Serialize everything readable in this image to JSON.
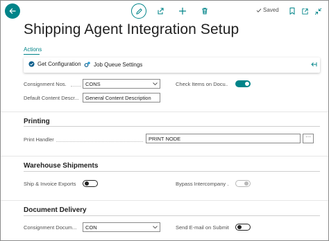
{
  "toolbar": {
    "saved_label": "Saved"
  },
  "page": {
    "title": "Shipping Agent Integration Setup"
  },
  "actions": {
    "tab_label": "Actions",
    "items": [
      {
        "label": "Get Configuration"
      },
      {
        "label": "Job Queue Settings"
      }
    ]
  },
  "general": {
    "consignment_nos": {
      "label": "Consignment Nos.",
      "value": "CONS"
    },
    "default_content": {
      "label": "Default Content Descr...",
      "value": "General Content Description"
    },
    "check_items": {
      "label": "Check Items on Docu...",
      "value": "on"
    }
  },
  "printing": {
    "title": "Printing",
    "print_handler": {
      "label": "Print Handler",
      "value": "PRINT NODE",
      "assist": "···"
    }
  },
  "warehouse": {
    "title": "Warehouse Shipments",
    "ship_invoice": {
      "label": "Ship & Invoice Exports",
      "value": "off"
    },
    "bypass": {
      "label": "Bypass Intercompany ...",
      "value": "on (disabled)"
    }
  },
  "delivery": {
    "title": "Document Delivery",
    "consignment_doc": {
      "label": "Consignment Docum...",
      "value": "CON"
    },
    "send_email": {
      "label": "Send E-mail on Submit",
      "value": "off"
    }
  },
  "colors": {
    "accent": "#008489",
    "text": "#212121",
    "muted": "#505050"
  }
}
